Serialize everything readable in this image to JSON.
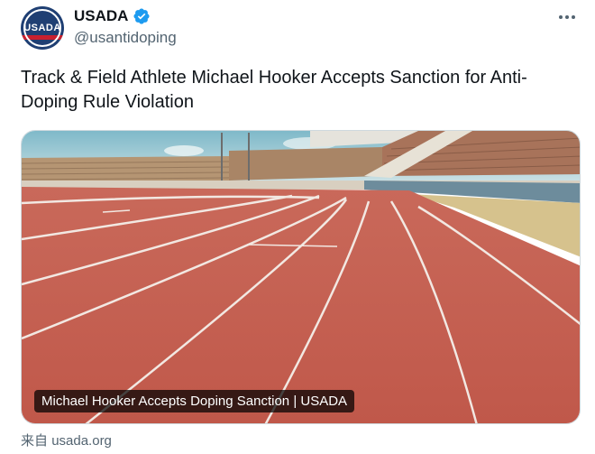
{
  "tweet": {
    "author": {
      "display_name": "USADA",
      "handle": "@usantidoping",
      "avatar_text": "USADA",
      "verified": true,
      "verified_color": "#1d9bf0"
    },
    "text": "Track & Field Athlete Michael Hooker Accepts Sanction for Anti-Doping Rule Violation",
    "card": {
      "image_caption": "Michael Hooker Accepts Doping Sanction | USADA",
      "source_prefix": "来自",
      "source_domain": "usada.org"
    },
    "more_icon": "more-options-icon"
  }
}
